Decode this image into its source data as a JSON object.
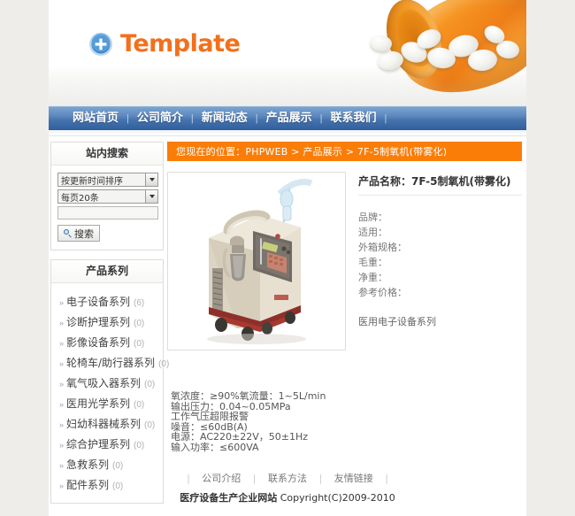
{
  "site": {
    "logo_text": "Template",
    "logo_icon": "plus-circle-icon"
  },
  "nav": {
    "items": [
      {
        "label": "网站首页"
      },
      {
        "label": "公司简介"
      },
      {
        "label": "新闻动态"
      },
      {
        "label": "产品展示"
      },
      {
        "label": "联系我们"
      }
    ],
    "separator": "|"
  },
  "sidebar": {
    "search": {
      "title": "站内搜索",
      "sort_select": "按更新时间排序",
      "perpage_select": "每页20条",
      "keyword_value": "",
      "keyword_placeholder": "",
      "button_label": "搜索",
      "button_icon": "search-icon"
    },
    "categories": {
      "title": "产品系列",
      "bullet": "»",
      "items": [
        {
          "label": "电子设备系列",
          "count": "(6)"
        },
        {
          "label": "诊断护理系列",
          "count": "(0)"
        },
        {
          "label": "影像设备系列",
          "count": "(0)"
        },
        {
          "label": "轮椅车/助行器系列",
          "count": "(0)"
        },
        {
          "label": "氧气吸入器系列",
          "count": "(0)"
        },
        {
          "label": "医用光学系列",
          "count": "(0)"
        },
        {
          "label": "妇幼科器械系列",
          "count": "(0)"
        },
        {
          "label": "综合护理系列",
          "count": "(0)"
        },
        {
          "label": "急救系列",
          "count": "(0)"
        },
        {
          "label": "配件系列",
          "count": "(0)"
        }
      ]
    }
  },
  "main": {
    "breadcrumb": "您现在的位置：PHPWEB > 产品展示 > 7F-5制氧机(带雾化)",
    "product": {
      "image_alt": "7F-5制氧机(带雾化) 产品图片",
      "name": "产品名称：7F-5制氧机(带雾化)",
      "fields": [
        "品牌：",
        "适用：",
        "外箱规格：",
        "毛重：",
        "净重：",
        "参考价格："
      ],
      "category": "医用电子设备系列",
      "specs": [
        "氧浓度：≥90%氧流量：1~5L/min",
        "输出压力：0.04~0.05MPa",
        "工作气压超限报警",
        "噪音：≤60dB(A)",
        "电源：AC220±22V，50±1Hz",
        "输入功率：≤600VA"
      ]
    }
  },
  "footer": {
    "sep": "|",
    "links": [
      {
        "label": "公司介绍"
      },
      {
        "label": "联系方法"
      },
      {
        "label": "友情链接"
      }
    ],
    "site_name": "医疗设备生产企业网站",
    "copyright": "Copyright(C)2009-2010"
  },
  "colors": {
    "accent_orange": "#f97d07",
    "logo_orange": "#f2701d",
    "nav_blue": "#4472ad",
    "page_bg": "#efedea"
  }
}
